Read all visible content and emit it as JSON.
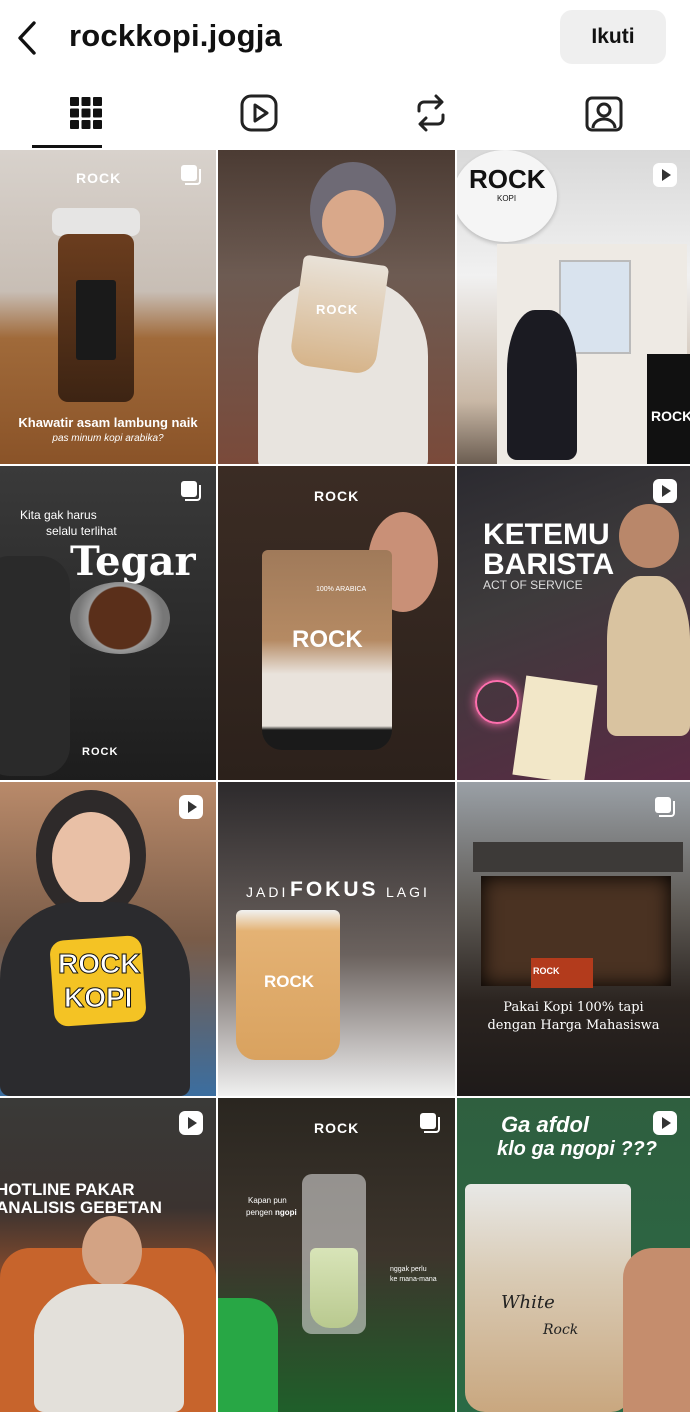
{
  "header": {
    "username": "rockkopi.jogja",
    "follow_label": "Ikuti"
  },
  "tabs": [
    {
      "name": "grid-icon",
      "active": true
    },
    {
      "name": "reels-icon",
      "active": false
    },
    {
      "name": "reposts-icon",
      "active": false
    },
    {
      "name": "tagged-icon",
      "active": false
    }
  ],
  "posts": [
    {
      "type": "carousel",
      "brand": "ROCK",
      "caption": "Khawatir asam lambung naik",
      "subcaption": "pas minum kopi arabika?"
    },
    {
      "type": "none",
      "brand": "ROCK"
    },
    {
      "type": "reel",
      "brand": "ROCK",
      "sub": "KOPI"
    },
    {
      "type": "carousel",
      "line1": "Kita gak harus",
      "line2": "selalu terlihat",
      "headline": "Tegar",
      "brand": "ROCK"
    },
    {
      "type": "none",
      "brand": "ROCK",
      "cup_label": "ROCK",
      "cup_small": "100% ARABICA"
    },
    {
      "type": "reel",
      "headline1": "KETEMU",
      "headline2": "BARISTA",
      "subline": "ACT OF SERVICE"
    },
    {
      "type": "reel",
      "sticker1": "ROCK",
      "sticker2": "KOPI"
    },
    {
      "type": "none",
      "pre": "JADI",
      "focus": "FOKUS",
      "post": "LAGI",
      "cup_label": "ROCK"
    },
    {
      "type": "carousel",
      "line1": "Pakai Kopi 100% tapi",
      "line2": "dengan Harga Mahasiswa",
      "sign": "ROCK"
    },
    {
      "type": "reel",
      "line1": "HOTLINE PAKAR",
      "line2": "ANALISIS GEBETAN"
    },
    {
      "type": "carousel",
      "brand": "ROCK",
      "line1": "Kapan pun",
      "line2": "pengen",
      "line2b": "ngopi",
      "side1": "nggak perlu",
      "side2": "ke mana-mana"
    },
    {
      "type": "reel",
      "line1": "Ga afdol",
      "line2": "klo ga ngopi ???",
      "cup1": "White",
      "cup2": "Rock"
    }
  ]
}
